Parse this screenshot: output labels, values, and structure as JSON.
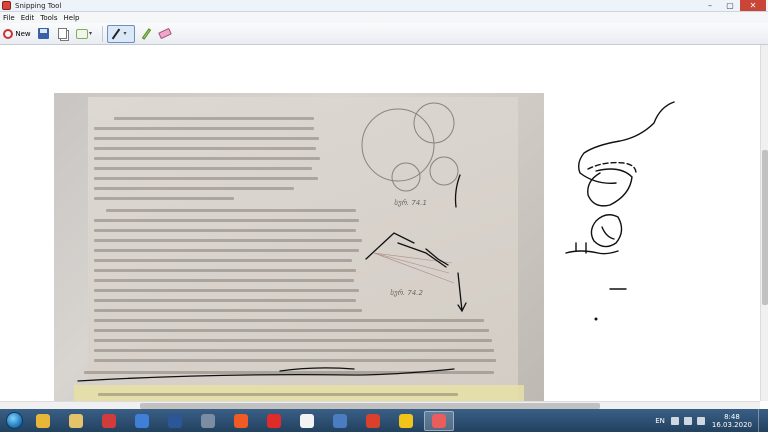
{
  "window": {
    "title": "Snipping Tool"
  },
  "menu": [
    "File",
    "Edit",
    "Tools",
    "Help"
  ],
  "toolbar": {
    "new_label": "New"
  },
  "photo": {
    "caption_1": "სურ. 74.1",
    "caption_2": "სურ. 74.2"
  },
  "taskbar": {
    "apps": [
      {
        "name": "chrome",
        "color": "#e8b73a"
      },
      {
        "name": "file-explorer",
        "color": "#e4c36a"
      },
      {
        "name": "paint",
        "color": "#d23b3b"
      },
      {
        "name": "chromium",
        "color": "#3f7fd8"
      },
      {
        "name": "word",
        "color": "#2b5797"
      },
      {
        "name": "settings",
        "color": "#7b8da3"
      },
      {
        "name": "brave",
        "color": "#f05a24"
      },
      {
        "name": "yandex",
        "color": "#e02b2b"
      },
      {
        "name": "yandex-browser",
        "color": "#f3f3f3"
      },
      {
        "name": "media",
        "color": "#4a7cc1"
      },
      {
        "name": "ccleaner",
        "color": "#d9412c"
      },
      {
        "name": "windows-security",
        "color": "#f0c419"
      },
      {
        "name": "snipping-tool",
        "color": "#e95d5d"
      }
    ],
    "language": "EN",
    "time": "8:48",
    "date": "16.03.2020"
  }
}
